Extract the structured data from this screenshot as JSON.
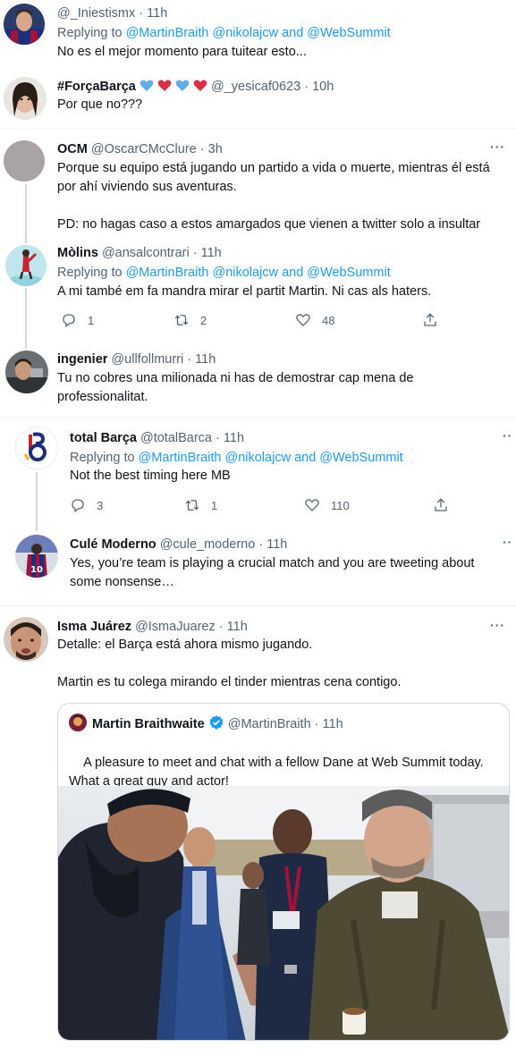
{
  "tweets": [
    {
      "name": "",
      "handle": "@_Iniestismx",
      "sep": "·",
      "time": "11h",
      "reply_prefix": "Replying to",
      "reply_to": "@MartinBraith @nikolajcw and @WebSummit",
      "text": "No es el mejor momento para tuitear esto..."
    },
    {
      "name": "#ForçaBarça",
      "handle": "@_yesicaf0623",
      "sep": "·",
      "time": "10h",
      "text": "Por que no???"
    },
    {
      "name": "OCM",
      "handle": "@OscarCMcClure",
      "sep": "·",
      "time": "3h",
      "text": "Porque su equipo está jugando un partido a vida o muerte, mientras él está por ahí viviendo sus aventuras.\n\nPD: no hagas caso a estos amargados que vienen a twitter solo a insultar"
    },
    {
      "name": "Mòlins",
      "handle": "@ansalcontrari",
      "sep": "·",
      "time": "11h",
      "reply_prefix": "Replying to",
      "reply_to": "@MartinBraith @nikolajcw and @WebSummit",
      "text": "A mi també em fa mandra mirar el partit Martin. Ni cas als haters.",
      "replies": "1",
      "retweets": "2",
      "likes": "48"
    },
    {
      "name": "ingenier",
      "handle": "@ullfollmurri",
      "sep": "·",
      "time": "11h",
      "text": "Tu no cobres una milionada ni has de demostrar cap mena de professionalitat."
    },
    {
      "name": "total Barça",
      "handle": "@totalBarca",
      "sep": "·",
      "time": "11h",
      "reply_prefix": "Replying to",
      "reply_to": "@MartinBraith @nikolajcw and @WebSummit",
      "text": "Not the best timing here MB",
      "replies": "3",
      "retweets": "1",
      "likes": "110"
    },
    {
      "name": "Culé Moderno",
      "handle": "@cule_moderno",
      "sep": "·",
      "time": "11h",
      "text": "Yes, you’re team is playing a crucial match and you are tweeting about some nonsense…"
    },
    {
      "name": "Isma Juárez",
      "handle": "@IsmaJuarez",
      "sep": "·",
      "time": "11h",
      "text": "Detalle: el Barça está ahora mismo jugando.\n\nMartin es tu colega mirando el tinder mientras cena contigo."
    }
  ],
  "quote": {
    "name": "Martin Braithwaite",
    "handle": "@MartinBraith",
    "sep": "·",
    "time": "11h",
    "text": "A pleasure to meet and chat with a fellow Dane at Web Summit today. What a great guy and actor!"
  },
  "colors": {
    "link": "#1d9bf0",
    "secondary": "#536471",
    "verified": "#1d9bf0",
    "heart_emoji": "#f91880",
    "blue_heart_emoji": "#5dadec"
  },
  "icons": [
    "more-icon",
    "reply-icon",
    "retweet-icon",
    "like-icon",
    "share-icon",
    "verified-icon",
    "heart-emoji",
    "blue-heart-emoji",
    "grinning-emoji"
  ]
}
